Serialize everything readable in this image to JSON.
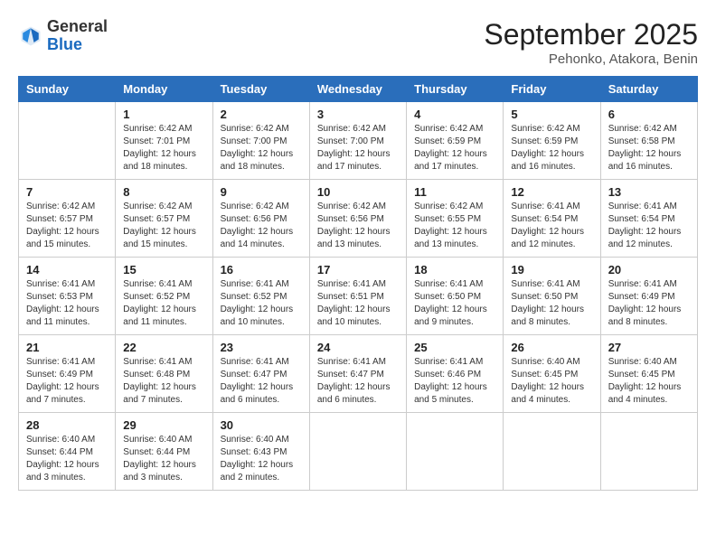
{
  "logo": {
    "general": "General",
    "blue": "Blue"
  },
  "header": {
    "month": "September 2025",
    "location": "Pehonko, Atakora, Benin"
  },
  "weekdays": [
    "Sunday",
    "Monday",
    "Tuesday",
    "Wednesday",
    "Thursday",
    "Friday",
    "Saturday"
  ],
  "weeks": [
    [
      {
        "day": "",
        "info": ""
      },
      {
        "day": "1",
        "info": "Sunrise: 6:42 AM\nSunset: 7:01 PM\nDaylight: 12 hours\nand 18 minutes."
      },
      {
        "day": "2",
        "info": "Sunrise: 6:42 AM\nSunset: 7:00 PM\nDaylight: 12 hours\nand 18 minutes."
      },
      {
        "day": "3",
        "info": "Sunrise: 6:42 AM\nSunset: 7:00 PM\nDaylight: 12 hours\nand 17 minutes."
      },
      {
        "day": "4",
        "info": "Sunrise: 6:42 AM\nSunset: 6:59 PM\nDaylight: 12 hours\nand 17 minutes."
      },
      {
        "day": "5",
        "info": "Sunrise: 6:42 AM\nSunset: 6:59 PM\nDaylight: 12 hours\nand 16 minutes."
      },
      {
        "day": "6",
        "info": "Sunrise: 6:42 AM\nSunset: 6:58 PM\nDaylight: 12 hours\nand 16 minutes."
      }
    ],
    [
      {
        "day": "7",
        "info": "Sunrise: 6:42 AM\nSunset: 6:57 PM\nDaylight: 12 hours\nand 15 minutes."
      },
      {
        "day": "8",
        "info": "Sunrise: 6:42 AM\nSunset: 6:57 PM\nDaylight: 12 hours\nand 15 minutes."
      },
      {
        "day": "9",
        "info": "Sunrise: 6:42 AM\nSunset: 6:56 PM\nDaylight: 12 hours\nand 14 minutes."
      },
      {
        "day": "10",
        "info": "Sunrise: 6:42 AM\nSunset: 6:56 PM\nDaylight: 12 hours\nand 13 minutes."
      },
      {
        "day": "11",
        "info": "Sunrise: 6:42 AM\nSunset: 6:55 PM\nDaylight: 12 hours\nand 13 minutes."
      },
      {
        "day": "12",
        "info": "Sunrise: 6:41 AM\nSunset: 6:54 PM\nDaylight: 12 hours\nand 12 minutes."
      },
      {
        "day": "13",
        "info": "Sunrise: 6:41 AM\nSunset: 6:54 PM\nDaylight: 12 hours\nand 12 minutes."
      }
    ],
    [
      {
        "day": "14",
        "info": "Sunrise: 6:41 AM\nSunset: 6:53 PM\nDaylight: 12 hours\nand 11 minutes."
      },
      {
        "day": "15",
        "info": "Sunrise: 6:41 AM\nSunset: 6:52 PM\nDaylight: 12 hours\nand 11 minutes."
      },
      {
        "day": "16",
        "info": "Sunrise: 6:41 AM\nSunset: 6:52 PM\nDaylight: 12 hours\nand 10 minutes."
      },
      {
        "day": "17",
        "info": "Sunrise: 6:41 AM\nSunset: 6:51 PM\nDaylight: 12 hours\nand 10 minutes."
      },
      {
        "day": "18",
        "info": "Sunrise: 6:41 AM\nSunset: 6:50 PM\nDaylight: 12 hours\nand 9 minutes."
      },
      {
        "day": "19",
        "info": "Sunrise: 6:41 AM\nSunset: 6:50 PM\nDaylight: 12 hours\nand 8 minutes."
      },
      {
        "day": "20",
        "info": "Sunrise: 6:41 AM\nSunset: 6:49 PM\nDaylight: 12 hours\nand 8 minutes."
      }
    ],
    [
      {
        "day": "21",
        "info": "Sunrise: 6:41 AM\nSunset: 6:49 PM\nDaylight: 12 hours\nand 7 minutes."
      },
      {
        "day": "22",
        "info": "Sunrise: 6:41 AM\nSunset: 6:48 PM\nDaylight: 12 hours\nand 7 minutes."
      },
      {
        "day": "23",
        "info": "Sunrise: 6:41 AM\nSunset: 6:47 PM\nDaylight: 12 hours\nand 6 minutes."
      },
      {
        "day": "24",
        "info": "Sunrise: 6:41 AM\nSunset: 6:47 PM\nDaylight: 12 hours\nand 6 minutes."
      },
      {
        "day": "25",
        "info": "Sunrise: 6:41 AM\nSunset: 6:46 PM\nDaylight: 12 hours\nand 5 minutes."
      },
      {
        "day": "26",
        "info": "Sunrise: 6:40 AM\nSunset: 6:45 PM\nDaylight: 12 hours\nand 4 minutes."
      },
      {
        "day": "27",
        "info": "Sunrise: 6:40 AM\nSunset: 6:45 PM\nDaylight: 12 hours\nand 4 minutes."
      }
    ],
    [
      {
        "day": "28",
        "info": "Sunrise: 6:40 AM\nSunset: 6:44 PM\nDaylight: 12 hours\nand 3 minutes."
      },
      {
        "day": "29",
        "info": "Sunrise: 6:40 AM\nSunset: 6:44 PM\nDaylight: 12 hours\nand 3 minutes."
      },
      {
        "day": "30",
        "info": "Sunrise: 6:40 AM\nSunset: 6:43 PM\nDaylight: 12 hours\nand 2 minutes."
      },
      {
        "day": "",
        "info": ""
      },
      {
        "day": "",
        "info": ""
      },
      {
        "day": "",
        "info": ""
      },
      {
        "day": "",
        "info": ""
      }
    ]
  ]
}
